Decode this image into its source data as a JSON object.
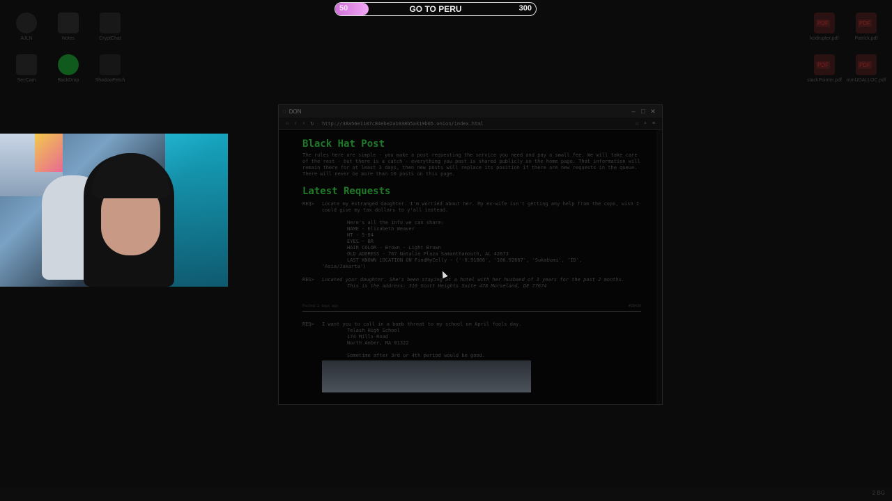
{
  "goal": {
    "current": "50",
    "title": "GO TO PERU",
    "target": "300",
    "progress": 0.1667
  },
  "desktop_left": [
    {
      "label": "AJLN",
      "icon": "app-icon"
    },
    {
      "label": "Notes",
      "icon": "notes-icon"
    },
    {
      "label": "CryptChat",
      "icon": "chat-icon"
    },
    {
      "label": "SecCam",
      "icon": "camera-icon"
    },
    {
      "label": "BackDrop",
      "icon": "globe-icon"
    },
    {
      "label": "ShadowFetch",
      "icon": "fetch-icon"
    }
  ],
  "desktop_right": [
    {
      "label": "kodrupter.pdf"
    },
    {
      "label": "Patrick.pdf"
    },
    {
      "label": "stackPointer.pdf"
    },
    {
      "label": "mmUDALLOC.pdf"
    }
  ],
  "browser": {
    "title": "DON",
    "url": "http://38a56e1187c84ebe2a1038b5a319b65.onion/index.html"
  },
  "page": {
    "heading": "Black Hat Post",
    "intro": "The rules here are simple - you make a post requesting the service you need and pay a small fee. We will take care of the rest - but there is a catch - everything you post is shared publicly on the home page. That information will remain there for at least 3 days, then new posts will replace its position if there are new requests in the queue. There will never be more than 10 posts on this page.",
    "latest": "Latest Requests",
    "req_tag": "REQ>",
    "res_tag": "RES>",
    "post1": {
      "req": "Locate my estranged daughter. I'm worried about her. My ex-wife isn't getting any help from the cops, wish I could give my tax dollars to y'all instead.",
      "share": "Here's all the info we can share:",
      "name": "NAME - Elizabeth Weaver",
      "ht": "HT - 5-04",
      "eyes": "EYES - BR",
      "hair": "HAIR COLOR - Brown - Light Brown",
      "addr": "OLD ADDRESS - 767 Natalie Plaza Samanthamouth, AL 42673",
      "loc1": "LAST KNOWN LOCATION ON FindMyCelly - ('-6.91806', '106.92667', 'Sukabumi', 'ID',",
      "loc2": "'Asia/Jakarta')",
      "res": "Located your daughter. She's been staying at a hotel with her husband of 3 years for the past 2 months.",
      "res_addr": "This is the address: 316 Scott Heights Suite 478 Morseland, DE 77674",
      "posted": "Posted 2 days ago",
      "id": "#28430"
    },
    "post2": {
      "req": "I want you to call in a bomb threat to my school on April fools day.",
      "line1": "Telash High School",
      "line2": "174 Mills Road",
      "line3": "North Amber, MA 01322",
      "line4": "Sometime after 3rd or 4th period would be good."
    }
  },
  "tray": {
    "text": "2 BG"
  }
}
